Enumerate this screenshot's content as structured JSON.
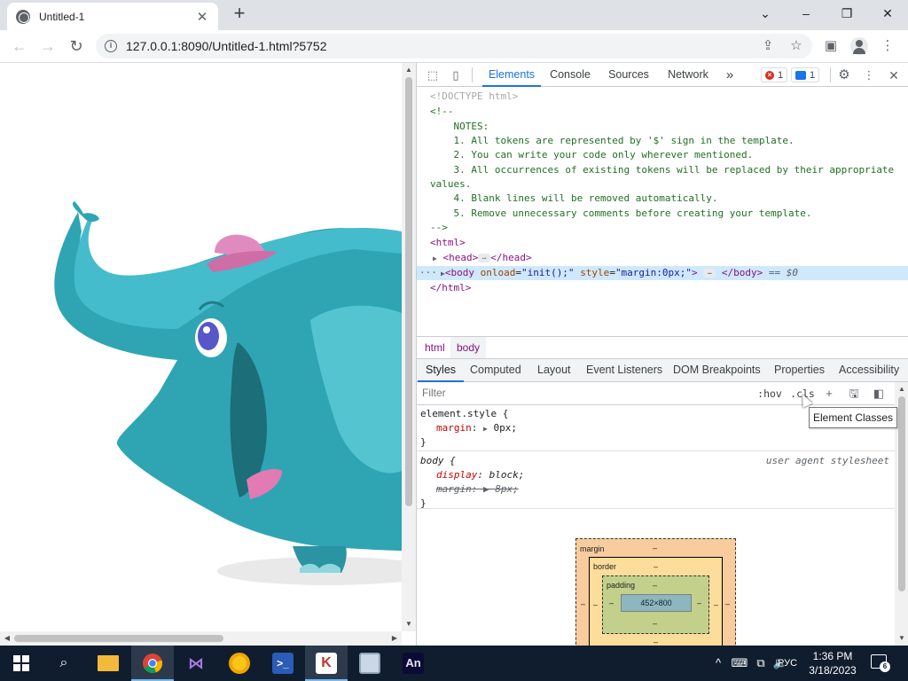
{
  "browser": {
    "tab_title": "Untitled-1",
    "tab_close": "✕",
    "new_tab": "+",
    "window_controls": {
      "minimize": "⌄",
      "min": "–",
      "restore": "❐",
      "close": "✕"
    },
    "url": "127.0.0.1:8090/Untitled-1.html?5752"
  },
  "devtools": {
    "tabs": [
      "Elements",
      "Console",
      "Sources",
      "Network"
    ],
    "more_tabs": "»",
    "error_count": "1",
    "message_count": "1",
    "dom": {
      "doctype": "<!DOCTYPE html>",
      "comment_open": "<!--",
      "notes": "    NOTES:",
      "note1": "    1. All tokens are represented by '$' sign in the template.",
      "note2": "    2. You can write your code only wherever mentioned.",
      "note3": "    3. All occurrences of existing tokens will be replaced by their appropriate",
      "note3b": "values.",
      "note4": "    4. Blank lines will be removed automatically.",
      "note5": "    5. Remove unnecessary comments before creating your template.",
      "comment_close": "-->",
      "html_open": "<html>",
      "head_open": "<head>",
      "head_close": "</head>",
      "body_open": "<body",
      "body_attr1_name": "onload",
      "body_attr1_value": "\"init();\"",
      "body_attr2_name": "style",
      "body_attr2_value": "\"margin:0px;\"",
      "body_close": "</body>",
      "selected_marker": "== $0",
      "html_close": "</html>",
      "row_marker": "···"
    },
    "breadcrumbs": [
      "html",
      "body"
    ],
    "style_tabs": [
      "Styles",
      "Computed",
      "Layout",
      "Event Listeners",
      "DOM Breakpoints",
      "Properties",
      "Accessibility"
    ],
    "filter_placeholder": "Filter",
    "hov": ":hov",
    "cls": ".cls",
    "element_style": {
      "selector": "element.style {",
      "prop": "margin",
      "value": "0px;",
      "close": "}"
    },
    "body_rule": {
      "selector": "body {",
      "source": "user agent stylesheet",
      "prop1": "display",
      "value1": "block;",
      "prop2": "margin",
      "value2": "8px;",
      "close": "}"
    },
    "box_model": {
      "margin_label": "margin",
      "border_label": "border",
      "padding_label": "padding",
      "content_size": "452×800",
      "dash": "–"
    },
    "tooltip": "Element Classes"
  },
  "taskbar": {
    "lang": "РУС",
    "time": "1:36 PM",
    "date": "3/18/2023",
    "notifications": "6",
    "apps": [
      "File Explorer",
      "Google Chrome",
      "Visual Studio",
      "Chrome Canary",
      "PowerShell",
      "Kaspersky",
      "Control Panel",
      "Animate"
    ],
    "animate_label": "An"
  }
}
